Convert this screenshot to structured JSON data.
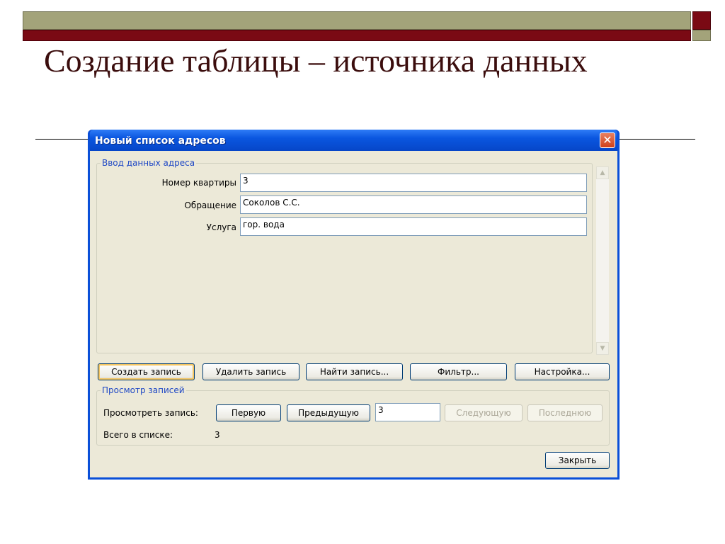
{
  "slide": {
    "title": "Создание таблицы – источника данных",
    "colors": {
      "olive": "#a3a37a",
      "maroon": "#7a0a14",
      "title": "#3b0d0d"
    }
  },
  "dialog": {
    "title": "Новый список адресов",
    "close_icon": "close-icon",
    "entry_group": {
      "legend": "Ввод данных адреса",
      "fields": [
        {
          "label": "Номер квартиры",
          "value": "3"
        },
        {
          "label": "Обращение",
          "value": "Соколов С.С."
        },
        {
          "label": "Услуга",
          "value": "гор. вода"
        }
      ]
    },
    "actions": {
      "create": "Создать запись",
      "delete": "Удалить запись",
      "find": "Найти запись...",
      "filter": "Фильтр...",
      "settings": "Настройка..."
    },
    "browse_group": {
      "legend": "Просмотр записей",
      "view_label": "Просмотреть запись:",
      "first": "Первую",
      "previous": "Предыдущую",
      "current": "3",
      "next": "Следующую",
      "last": "Последнюю",
      "total_label": "Всего в списке:",
      "total_value": "3"
    },
    "close_button": "Закрыть"
  }
}
